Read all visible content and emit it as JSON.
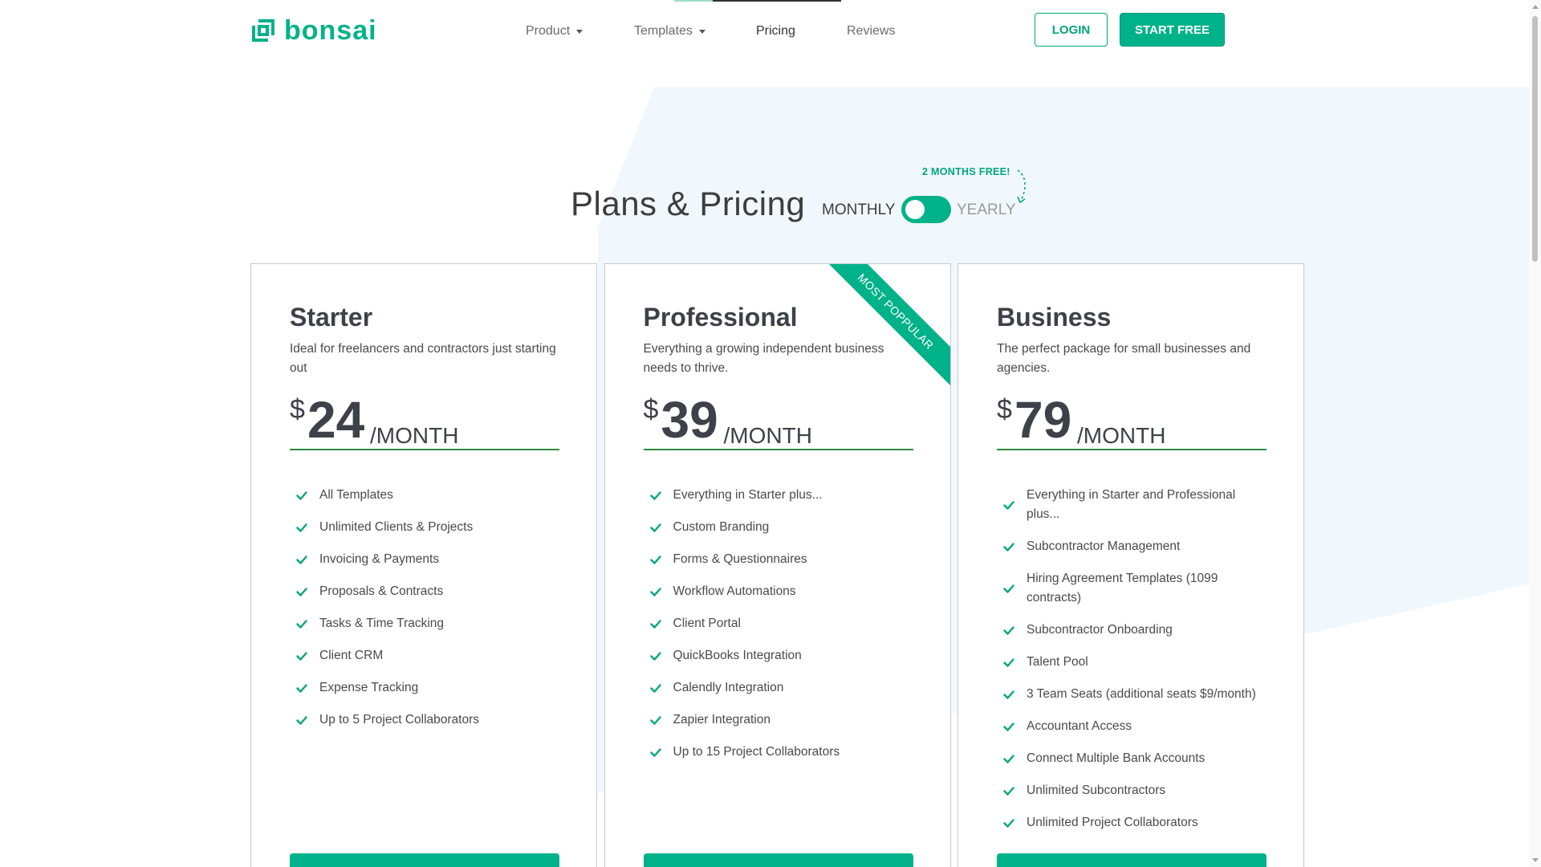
{
  "brand": {
    "name": "bonsai",
    "color": "#00b289"
  },
  "nav": {
    "items": [
      {
        "label": "Product",
        "has_dropdown": true
      },
      {
        "label": "Templates",
        "has_dropdown": true
      },
      {
        "label": "Pricing",
        "has_dropdown": false,
        "active": true
      },
      {
        "label": "Reviews",
        "has_dropdown": false
      }
    ],
    "login_label": "LOGIN",
    "start_label": "START FREE"
  },
  "pricing": {
    "title": "Plans & Pricing",
    "billing": {
      "monthly_label": "MONTHLY",
      "yearly_label": "YEARLY",
      "selected": "monthly",
      "promo": "2 MONTHS FREE!"
    }
  },
  "plans": [
    {
      "name": "Starter",
      "description": "Ideal for freelancers and contractors just starting out",
      "currency": "$",
      "price": "24",
      "period": "/MONTH",
      "features": [
        "All Templates",
        "Unlimited Clients & Projects",
        "Invoicing & Payments",
        "Proposals & Contracts",
        "Tasks & Time Tracking",
        "Client CRM",
        "Expense Tracking",
        "Up to 5 Project Collaborators"
      ]
    },
    {
      "name": "Professional",
      "description": "Everything a growing independent business needs to thrive.",
      "currency": "$",
      "price": "39",
      "period": "/MONTH",
      "badge": "MOST POPPULAR",
      "features": [
        "Everything in Starter plus...",
        "Custom Branding",
        "Forms & Questionnaires",
        "Workflow Automations",
        "Client Portal",
        "QuickBooks Integration",
        "Calendly Integration",
        "Zapier Integration",
        "Up to 15 Project Collaborators"
      ]
    },
    {
      "name": "Business",
      "description": "The perfect package for small businesses and agencies.",
      "currency": "$",
      "price": "79",
      "period": "/MONTH",
      "features": [
        "Everything in Starter and Professional plus...",
        "Subcontractor Management",
        "Hiring Agreement Templates (1099 contracts)",
        "Subcontractor Onboarding",
        "Talent Pool",
        "3 Team Seats (additional seats $9/month)",
        "Accountant Access",
        "Connect Multiple Bank Accounts",
        "Unlimited Subcontractors",
        "Unlimited Project Collaborators"
      ]
    }
  ]
}
